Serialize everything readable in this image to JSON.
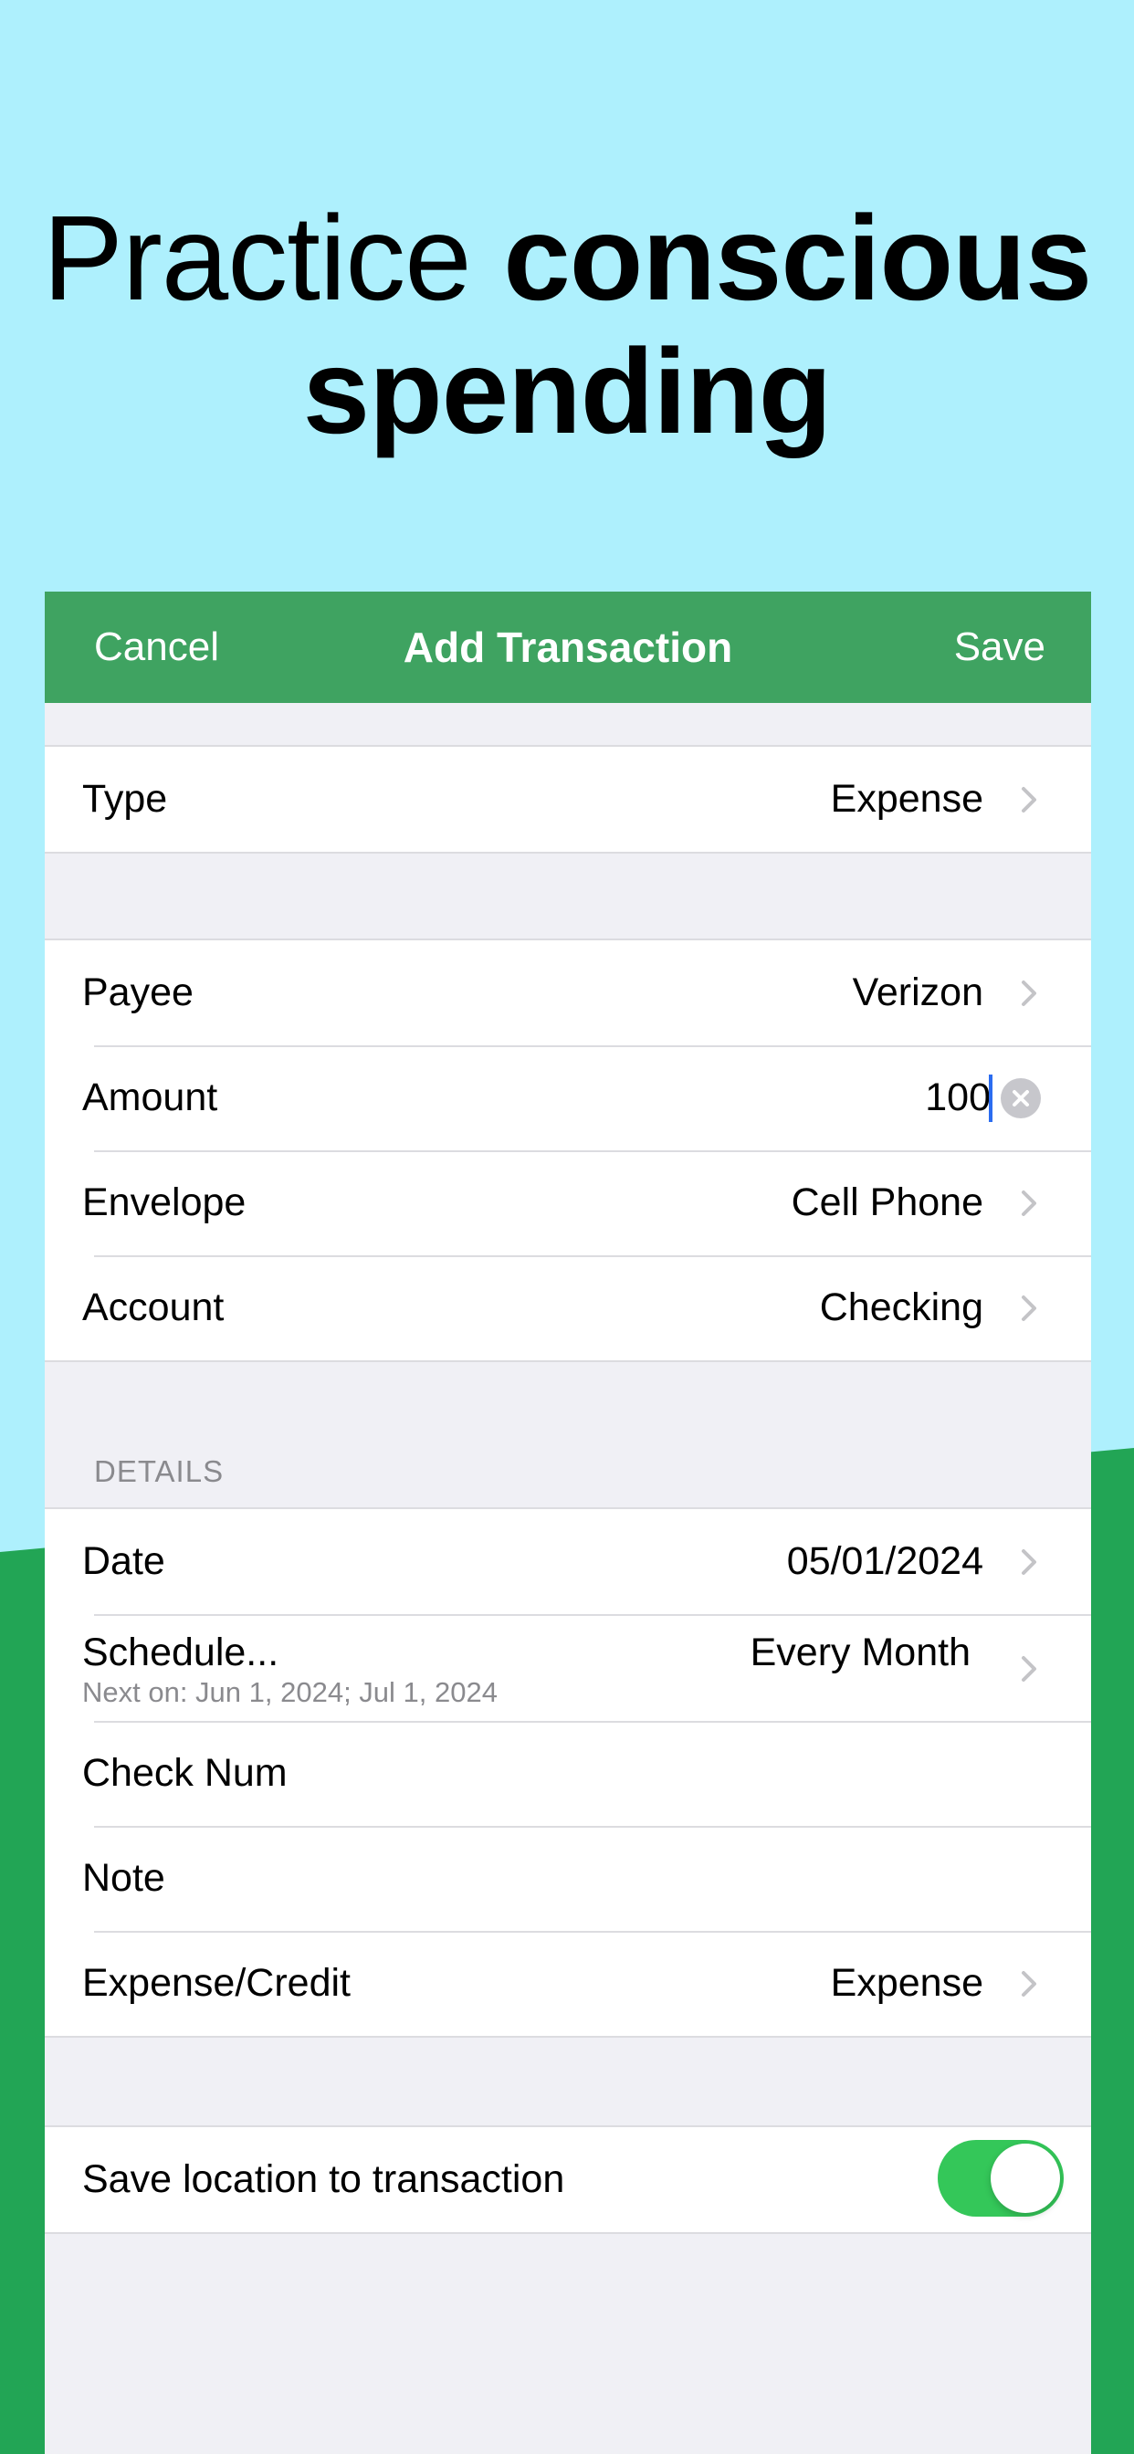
{
  "headline": {
    "light": "Practice",
    "bold_1": "conscious",
    "bold_2": "spending"
  },
  "navbar": {
    "cancel": "Cancel",
    "title": "Add Transaction",
    "save": "Save"
  },
  "type_row": {
    "label": "Type",
    "value": "Expense"
  },
  "main_rows": [
    {
      "label": "Payee",
      "value": "Verizon"
    },
    {
      "label": "Amount",
      "value": "100"
    },
    {
      "label": "Envelope",
      "value": "Cell Phone"
    },
    {
      "label": "Account",
      "value": "Checking"
    }
  ],
  "details": {
    "header": "DETAILS",
    "date": {
      "label": "Date",
      "value": "05/01/2024"
    },
    "schedule": {
      "label": "Schedule...",
      "sub": "Next on: Jun 1, 2024; Jul 1, 2024",
      "value": "Every Month"
    },
    "check_num": {
      "label": "Check Num",
      "value": ""
    },
    "note": {
      "label": "Note",
      "value": ""
    },
    "expense_credit": {
      "label": "Expense/Credit",
      "value": "Expense"
    }
  },
  "location": {
    "label": "Save location to transaction",
    "enabled": true
  },
  "colors": {
    "navbar": "#3fa361",
    "toggle_on": "#34c759",
    "background_top": "#aef0fd",
    "background_bottom": "#22a555",
    "caret": "#2b6cf0"
  },
  "icons": {
    "chevron": "chevron-right-icon",
    "clear": "clear-circle-icon"
  }
}
